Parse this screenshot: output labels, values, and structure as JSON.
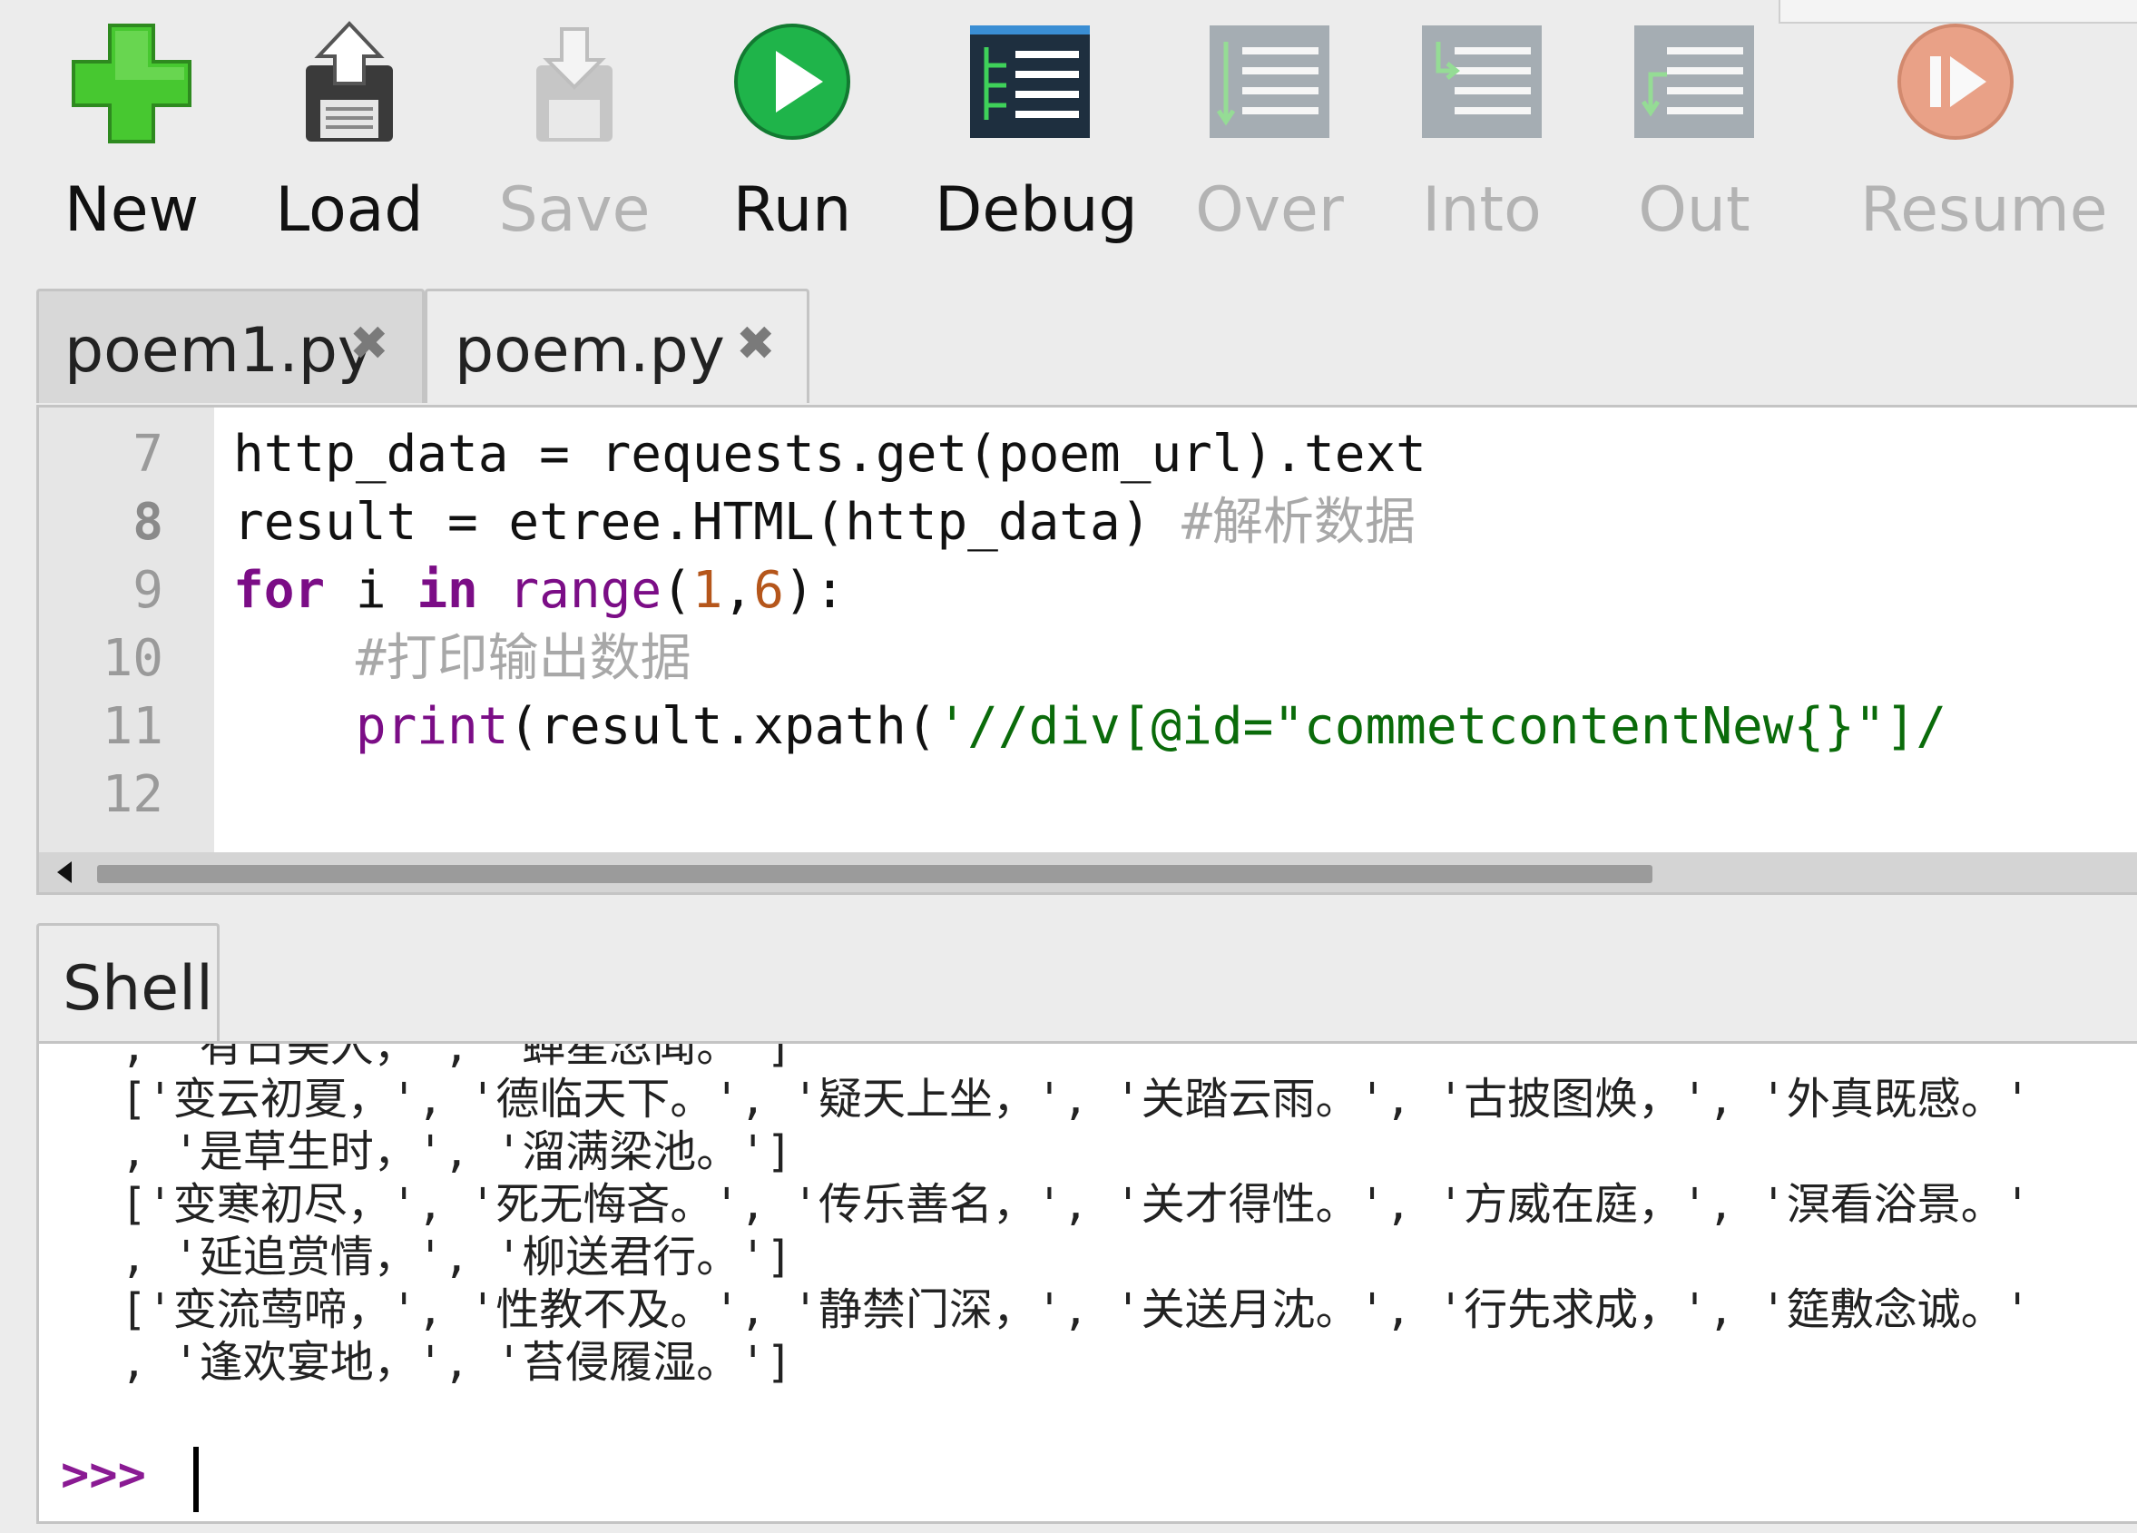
{
  "toolbar": {
    "buttons": [
      {
        "label": "New",
        "icon": "plus-icon",
        "enabled": true
      },
      {
        "label": "Load",
        "icon": "load-floppy-icon",
        "enabled": true
      },
      {
        "label": "Save",
        "icon": "save-floppy-icon",
        "enabled": false
      },
      {
        "label": "Run",
        "icon": "run-play-icon",
        "enabled": true
      },
      {
        "label": "Debug",
        "icon": "debug-icon",
        "enabled": true
      },
      {
        "label": "Over",
        "icon": "step-over-icon",
        "enabled": false
      },
      {
        "label": "Into",
        "icon": "step-into-icon",
        "enabled": false
      },
      {
        "label": "Out",
        "icon": "step-out-icon",
        "enabled": false
      },
      {
        "label": "Resume",
        "icon": "resume-icon",
        "enabled": false
      }
    ]
  },
  "editor": {
    "tabs": [
      {
        "label": "poem1.py",
        "active": false
      },
      {
        "label": "poem.py",
        "active": true
      }
    ],
    "line_numbers": [
      "7",
      "8",
      "9",
      "10",
      "11",
      "12"
    ],
    "current_line": "8",
    "lines": [
      {
        "t1": "http_data = requests.get(poem_url).text"
      },
      {
        "t1": "result = etree.HTML(http_data) ",
        "cmt": "#解析数据"
      },
      {
        "kw1": "for",
        "t1": " i ",
        "kw2": "in",
        "t2": " ",
        "bi": "range",
        "p1": "(",
        "n1": "1",
        "p2": ",",
        "n2": "6",
        "p3": "):"
      },
      {
        "cmt": "    #打印输出数据"
      },
      {
        "ind": "    ",
        "bi": "print",
        "t1": "(result.xpath(",
        "str": "'//div[@id=\"commetcontentNew{}\"]/"
      },
      {
        "t1": ""
      }
    ]
  },
  "shell": {
    "tab_label": "Shell",
    "output_lines": [
      ", '有日美人，', '蝉星忽闻。']",
      "['变云初夏，', '德临天下。', '疑天上坐，', '关踏云雨。', '古披图焕，', '外真既感。'",
      ", '是草生时，', '溜满梁池。']",
      "['变寒初尽，', '死无悔吝。', '传乐善名，', '关才得性。', '方威在庭，', '溟看浴景。'",
      ", '延追赏情，', '柳送君行。']",
      "['变流莺啼，', '性教不及。', '静禁门深，', '关送月沈。', '行先求成，', '筵敷念诚。'",
      ", '逢欢宴地，', '苔侵履湿。']"
    ],
    "prompt": ">>>"
  }
}
